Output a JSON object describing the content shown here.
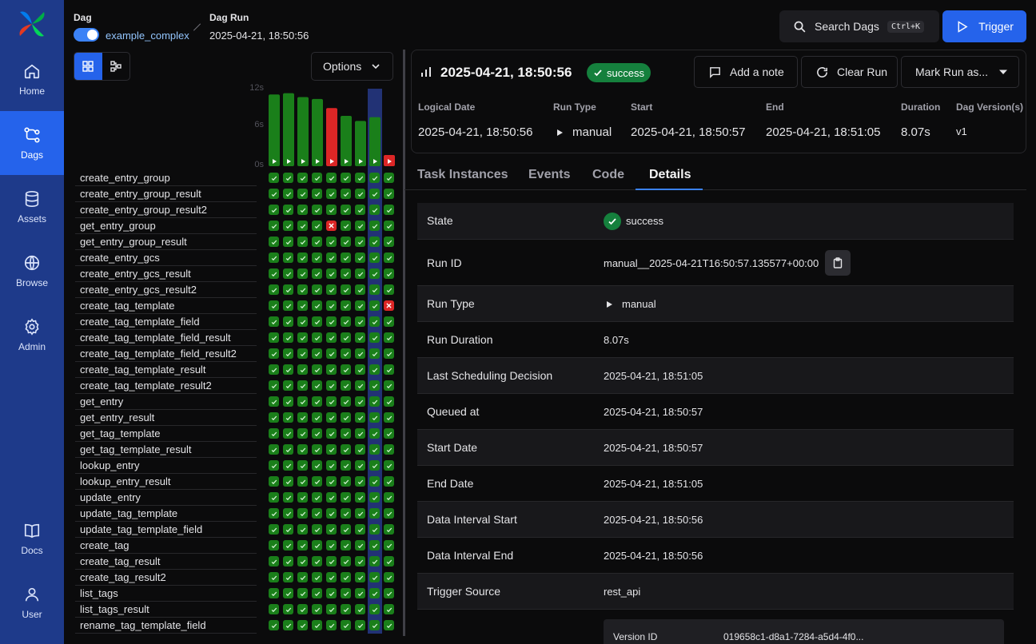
{
  "sidebar": {
    "items": [
      {
        "label": "Home",
        "icon": "home-icon"
      },
      {
        "label": "Dags",
        "icon": "dags-icon",
        "active": true
      },
      {
        "label": "Assets",
        "icon": "database-icon"
      },
      {
        "label": "Browse",
        "icon": "globe-icon"
      },
      {
        "label": "Admin",
        "icon": "gear-icon"
      },
      {
        "label": "Docs",
        "icon": "book-icon"
      },
      {
        "label": "User",
        "icon": "user-icon"
      }
    ]
  },
  "header": {
    "dag_label": "Dag",
    "dag_name": "example_complex",
    "run_label": "Dag Run",
    "run_value": "2025-04-21, 18:50:56",
    "search_label": "Search Dags",
    "search_shortcut": "Ctrl+K",
    "trigger_label": "Trigger"
  },
  "grid": {
    "options_label": "Options",
    "axis": [
      "12s",
      "6s",
      "0s"
    ],
    "runs": [
      {
        "duration": 11.1,
        "state": "success"
      },
      {
        "duration": 11.3,
        "state": "success"
      },
      {
        "duration": 10.7,
        "state": "success"
      },
      {
        "duration": 10.4,
        "state": "success"
      },
      {
        "duration": 9.0,
        "state": "failed"
      },
      {
        "duration": 7.8,
        "state": "success"
      },
      {
        "duration": 7.0,
        "state": "success"
      },
      {
        "duration": 7.6,
        "state": "success",
        "selected": true
      },
      {
        "duration": 0.6,
        "state": "failed"
      }
    ],
    "failures": [
      {
        "task": 3,
        "run": 4
      },
      {
        "task": 8,
        "run": 8
      }
    ],
    "tasks": [
      "create_entry_group",
      "create_entry_group_result",
      "create_entry_group_result2",
      "get_entry_group",
      "get_entry_group_result",
      "create_entry_gcs",
      "create_entry_gcs_result",
      "create_entry_gcs_result2",
      "create_tag_template",
      "create_tag_template_field",
      "create_tag_template_field_result",
      "create_tag_template_field_result2",
      "create_tag_template_result",
      "create_tag_template_result2",
      "get_entry",
      "get_entry_result",
      "get_tag_template",
      "get_tag_template_result",
      "lookup_entry",
      "lookup_entry_result",
      "update_entry",
      "update_tag_template",
      "update_tag_template_field",
      "create_tag",
      "create_tag_result",
      "create_tag_result2",
      "list_tags",
      "list_tags_result",
      "rename_tag_template_field"
    ]
  },
  "run": {
    "title": "2025-04-21, 18:50:56",
    "state": "success",
    "add_note": "Add a note",
    "clear_run": "Clear Run",
    "mark_run": "Mark Run as...",
    "meta": [
      {
        "label": "Logical Date",
        "value": "2025-04-21, 18:50:56"
      },
      {
        "label": "Run Type",
        "value": "manual"
      },
      {
        "label": "Start",
        "value": "2025-04-21, 18:50:57"
      },
      {
        "label": "End",
        "value": "2025-04-21, 18:51:05"
      },
      {
        "label": "Duration",
        "value": "8.07s"
      },
      {
        "label": "Dag Version(s)",
        "value": "v1"
      }
    ]
  },
  "tabs": [
    "Task Instances",
    "Events",
    "Code",
    "Details"
  ],
  "details": [
    {
      "key": "State",
      "value": "success"
    },
    {
      "key": "Run ID",
      "value": "manual__2025-04-21T16:50:57.135577+00:00"
    },
    {
      "key": "Run Type",
      "value": "manual"
    },
    {
      "key": "Run Duration",
      "value": "8.07s"
    },
    {
      "key": "Last Scheduling Decision",
      "value": "2025-04-21, 18:51:05"
    },
    {
      "key": "Queued at",
      "value": "2025-04-21, 18:50:57"
    },
    {
      "key": "Start Date",
      "value": "2025-04-21, 18:50:57"
    },
    {
      "key": "End Date",
      "value": "2025-04-21, 18:51:05"
    },
    {
      "key": "Data Interval Start",
      "value": "2025-04-21, 18:50:56"
    },
    {
      "key": "Data Interval End",
      "value": "2025-04-21, 18:50:56"
    },
    {
      "key": "Trigger Source",
      "value": "rest_api"
    }
  ],
  "nested": {
    "key": "Version ID",
    "value": "019658c1-d8a1-7284-a5d4-4f0..."
  },
  "colors": {
    "success": "#1a7f1a",
    "failed": "#dc2626",
    "accent": "#2563eb",
    "sidebar": "#1e3a8a"
  }
}
